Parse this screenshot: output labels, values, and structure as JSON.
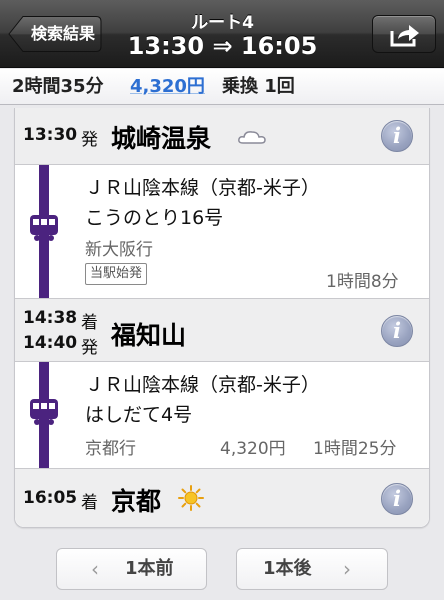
{
  "nav": {
    "back_label": "検索結果",
    "route_label": "ルート4",
    "time_range": "13:30 ⇒ 16:05",
    "share_icon": "share-icon"
  },
  "summary": {
    "duration": "2時間35分",
    "fare": "4,320円",
    "transfer": "乗換 1回"
  },
  "stops": [
    {
      "time": "13:30",
      "kind": "発",
      "station": "城崎温泉",
      "weather_icon": "cloud-icon"
    },
    {
      "arrive_time": "14:38",
      "arrive_kind": "着",
      "depart_time": "14:40",
      "depart_kind": "発",
      "station": "福知山"
    },
    {
      "time": "16:05",
      "kind": "着",
      "station": "京都",
      "weather_icon": "sun-icon"
    }
  ],
  "segments": [
    {
      "line": "ＪＲ山陰本線（京都-米子）",
      "train": "こうのとり16号",
      "direction": "新大阪行",
      "badge": "当駅始発",
      "fare": "",
      "duration": "1時間8分",
      "line_color": "#4b237f"
    },
    {
      "line": "ＪＲ山陰本線（京都-米子）",
      "train": "はしだて4号",
      "direction": "京都行",
      "fare": "4,320円",
      "duration": "1時間25分",
      "line_color": "#4b237f"
    }
  ],
  "info_button_label": "i",
  "pager": {
    "prev_label": "1本前",
    "next_label": "1本後",
    "prev_chevron": "‹",
    "next_chevron": "›"
  },
  "colors": {
    "fare_link": "#2d6fd2",
    "rail_line": "#4b237f"
  }
}
